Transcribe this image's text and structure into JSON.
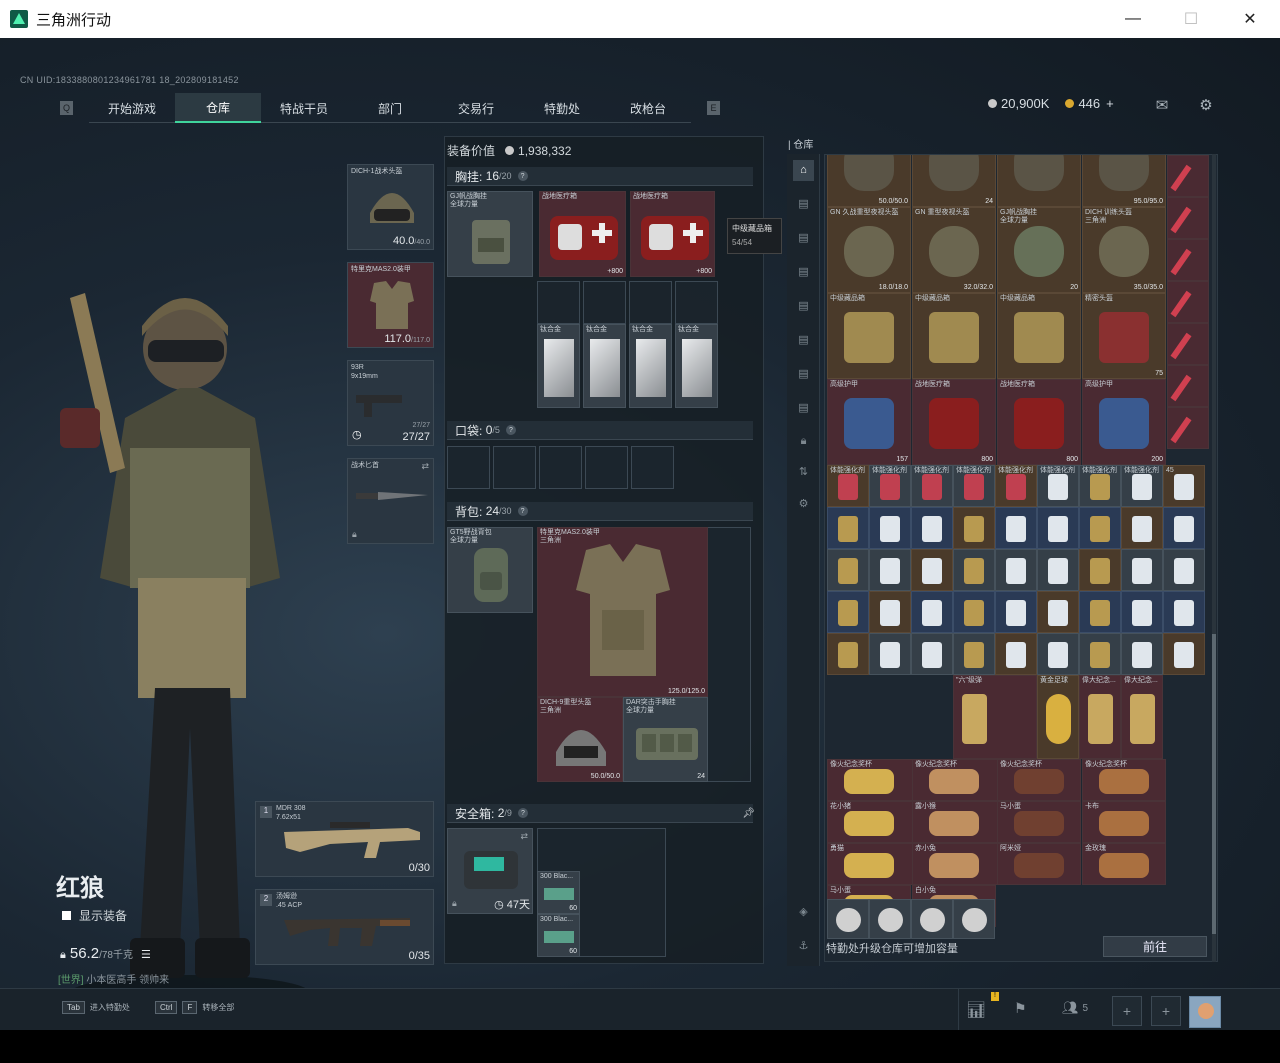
{
  "window": {
    "title": "三角洲行动"
  },
  "uid": "CN UID:1833880801234961781 18_202809181452",
  "nav": {
    "left_key": "Q",
    "right_key": "E",
    "tabs": [
      "开始游戏",
      "仓库",
      "特战干员",
      "部门",
      "交易行",
      "特勤处",
      "改枪台"
    ],
    "active": 1,
    "badge": "!"
  },
  "currency": {
    "coins": "20,900K",
    "tokens": "446",
    "plus": "+"
  },
  "equip": {
    "helmet": {
      "label": "DICH-1战术头盔",
      "value": "40.0",
      "max": "/40.0"
    },
    "armor": {
      "label": "特里克MAS2.0装甲",
      "value": "117.0",
      "max": "/117.0"
    },
    "pistol": {
      "label": "93R\n9x19mm",
      "ammo": "27/27",
      "ammo2": "27/27"
    },
    "melee": {
      "label": "战术匕首"
    },
    "primary": {
      "num": "1",
      "label": "MDR 308\n7.62x51",
      "ammo": "0/30"
    },
    "secondary": {
      "num": "2",
      "label": "汤姆逊\n.45 ACP",
      "ammo": "0/35"
    }
  },
  "operator": {
    "name": "红狼",
    "show_equip": "显示装备",
    "weight": "56.2",
    "weight_max": "/78千克",
    "status_prefix": "[世界]",
    "status": "小本医高手 领帅来"
  },
  "loadout": {
    "value_label": "装备价值",
    "value": "1,938,332",
    "chest": {
      "label": "胸挂:",
      "count": "16",
      "max": "/20"
    },
    "chest_item": "GJ帆战胸挂\n全球力量",
    "medkit1": {
      "name": "战地医疗箱",
      "count": "800"
    },
    "medkit2": {
      "name": "战地医疗箱",
      "count": "800"
    },
    "plates": [
      "钛合金",
      "钛合金",
      "钛合金",
      "钛合金"
    ],
    "pocket": {
      "label": "口袋:",
      "count": "0",
      "max": "/5"
    },
    "backpack": {
      "label": "背包:",
      "count": "24",
      "max": "/30"
    },
    "bp_item": "GT5野战背包\n全球力量",
    "armor_item": {
      "name": "特里克MAS2.0装甲\n三角洲",
      "value": "125.0/125.0"
    },
    "helmet_item": {
      "name": "DICH-9重型头盔\n三角洲",
      "value": "50.0/50.0"
    },
    "rig_item": {
      "name": "DAR突击手胸挂\n全球力量",
      "value": "24"
    },
    "safebox": {
      "label": "安全箱:",
      "count": "2",
      "max": "/9",
      "days": "47天"
    },
    "ammo1": {
      "name": "300 Blac...",
      "count": "60"
    },
    "ammo2": {
      "name": "300 Blac...",
      "count": "60"
    }
  },
  "tooltip": {
    "name": "中级藏品箱",
    "value": "54/54"
  },
  "stash": {
    "title": "仓库",
    "top_row": [
      {
        "c": "50.0/50.0"
      },
      {
        "c": "24"
      },
      {
        "c": ""
      },
      {
        "c": "95.0/95.0"
      }
    ],
    "row2": [
      {
        "n": "GN 久战重型夜视头盔",
        "c": "18.0/18.0"
      },
      {
        "n": "GN 重型夜视头盔",
        "c": "32.0/32.0"
      },
      {
        "n": "GJ帆战胸挂\n全球力量",
        "c": "20"
      },
      {
        "n": "DICH 训练头盔\n三角洲",
        "c": "35.0/35.0"
      }
    ],
    "row3": [
      {
        "n": "中级藏品箱",
        "c": ""
      },
      {
        "n": "中级藏品箱",
        "c": ""
      },
      {
        "n": "中级藏品箱",
        "c": ""
      },
      {
        "n": "精密头盔",
        "c": "75"
      }
    ],
    "row4": [
      {
        "n": "高级护甲",
        "c": "157"
      },
      {
        "n": "战地医疗箱",
        "c": "800"
      },
      {
        "n": "战地医疗箱",
        "c": "800"
      },
      {
        "n": "高级护甲",
        "c": "200"
      }
    ],
    "small_labels": [
      "体能强化剂",
      "体能强化剂",
      "体能强化剂",
      "体能强化剂",
      "体能强化剂",
      "体能强化剂",
      "体能强化剂",
      "体能强化剂",
      "45",
      "古剑",
      "蓝卡",
      "H1-密"
    ],
    "collect": [
      {
        "n": "\"六\"级弹"
      },
      {
        "n": "黄金足球"
      },
      {
        "n": "偉大纪念..."
      },
      {
        "n": "偉大纪念..."
      }
    ],
    "figures": [
      {
        "n": "像火纪念奖杯"
      },
      {
        "n": "像火纪念奖杯"
      },
      {
        "n": "像火纪念奖杯"
      },
      {
        "n": "像火纪念奖杯"
      },
      {
        "n": "花小猪"
      },
      {
        "n": "露小猴"
      },
      {
        "n": "马小蛋"
      },
      {
        "n": "卡布"
      },
      {
        "n": "勇猫"
      },
      {
        "n": "赤小兔"
      },
      {
        "n": "阿米娅"
      },
      {
        "n": "金玫瑰"
      },
      {
        "n": "马小蛋"
      },
      {
        "n": "白小兔"
      }
    ],
    "footer": "特勤处升级仓库可增加容量",
    "go_button": "前往"
  },
  "bottom": {
    "tab_key": "Tab",
    "tab_text": "进入特勤处",
    "ctrl_key": "Ctrl",
    "f_key": "F",
    "ctrl_text": "转移全部",
    "friends": "5"
  }
}
